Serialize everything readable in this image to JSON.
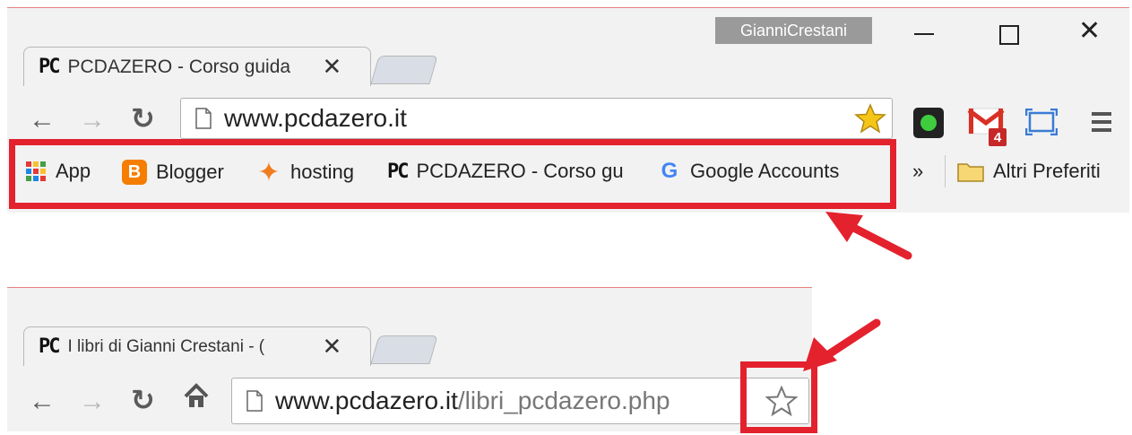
{
  "top_window": {
    "profile_name": "GianniCrestani",
    "tab": {
      "title": "PCDAZERO - Corso guida",
      "favicon": "PC"
    },
    "address_bar": {
      "url": "www.pcdazero.it"
    },
    "extension_badge": "4",
    "bookmarks": [
      {
        "label": "App",
        "icon": "apps-grid-icon"
      },
      {
        "label": "Blogger",
        "icon": "blogger-icon"
      },
      {
        "label": "hosting",
        "icon": "hosting-star-icon"
      },
      {
        "label": "PCDAZERO - Corso gu",
        "icon": "pc-logo-icon"
      },
      {
        "label": "Google Accounts",
        "icon": "google-g-icon"
      }
    ],
    "overflow_label": "»",
    "other_bookmarks_label": "Altri Preferiti"
  },
  "bottom_window": {
    "tab": {
      "title": "I libri di Gianni Crestani - (",
      "favicon": "PC"
    },
    "address_bar": {
      "host": "www.pcdazero.it",
      "path": "/libri_pcdazero.php"
    }
  },
  "colors": {
    "highlight_red": "#e3222e",
    "chrome_bg": "#f2f2f2",
    "omnibox_star_yellow": "#f5c518"
  }
}
